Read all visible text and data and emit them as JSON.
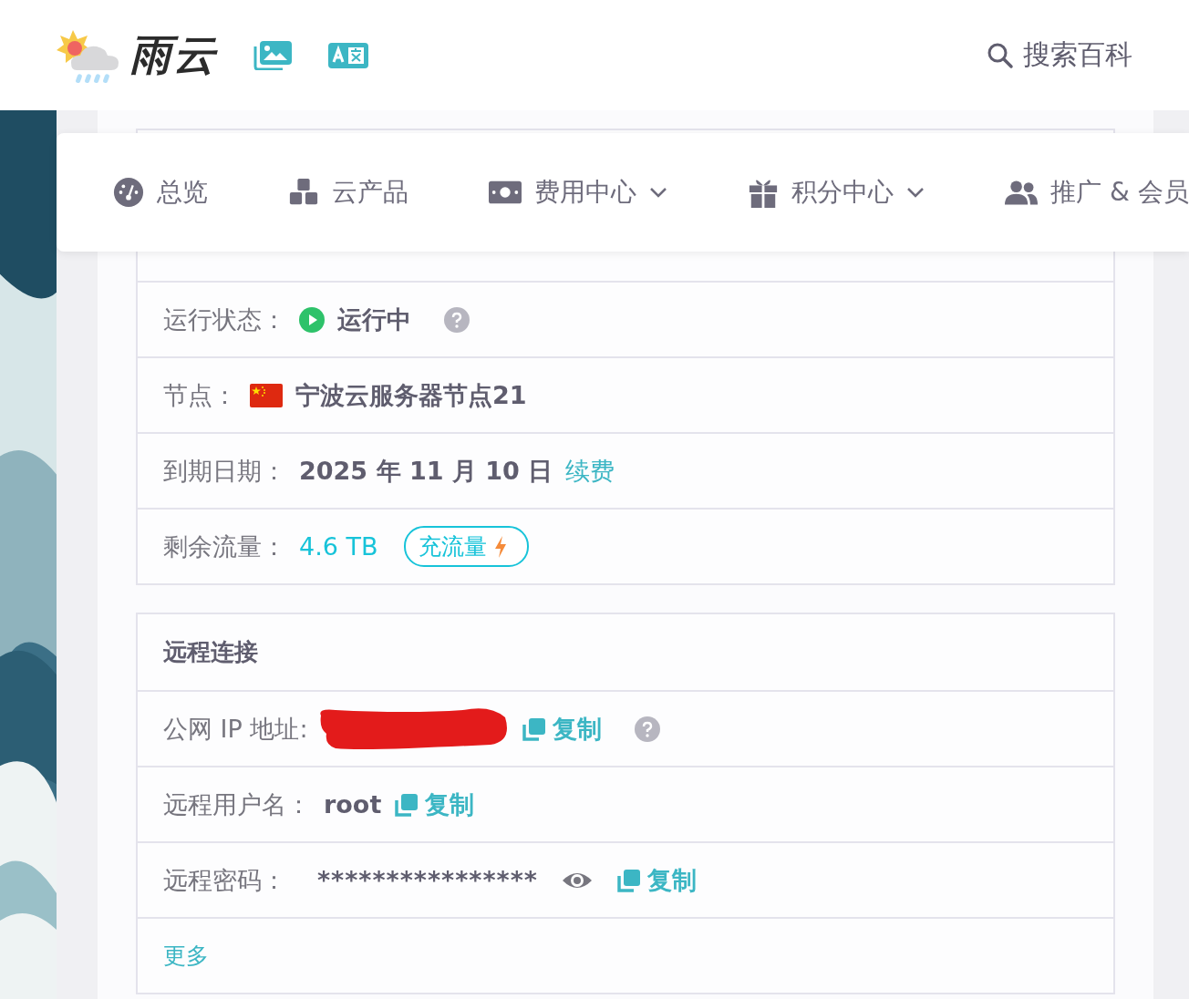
{
  "header": {
    "logo_text": "雨云",
    "search_label": "搜索百科"
  },
  "nav": [
    {
      "label": "总览",
      "dropdown": false
    },
    {
      "label": "云产品",
      "dropdown": false
    },
    {
      "label": "费用中心",
      "dropdown": true
    },
    {
      "label": "积分中心",
      "dropdown": true
    },
    {
      "label": "推广 & 会员",
      "dropdown": false
    }
  ],
  "info_rows": [
    {
      "kind": "status",
      "label": "运行状态：",
      "value": "运行中"
    },
    {
      "kind": "node",
      "label": "节点：",
      "value": "宁波云服务器节点21"
    },
    {
      "kind": "expiry",
      "label": "到期日期：",
      "value": "2025 年 11 月 10 日",
      "link": "续费"
    },
    {
      "kind": "traffic",
      "label": "剩余流量：",
      "value": "4.6 TB",
      "button": "充流量"
    }
  ],
  "remote": {
    "title": "远程连接",
    "rows": [
      {
        "kind": "ip",
        "label": "公网 IP 地址:",
        "copy": "复制"
      },
      {
        "kind": "user",
        "label": "远程用户名：",
        "value": "root",
        "copy": "复制"
      },
      {
        "kind": "password",
        "label": "远程密码：",
        "value": "****************",
        "copy": "复制"
      }
    ],
    "more": "更多"
  }
}
